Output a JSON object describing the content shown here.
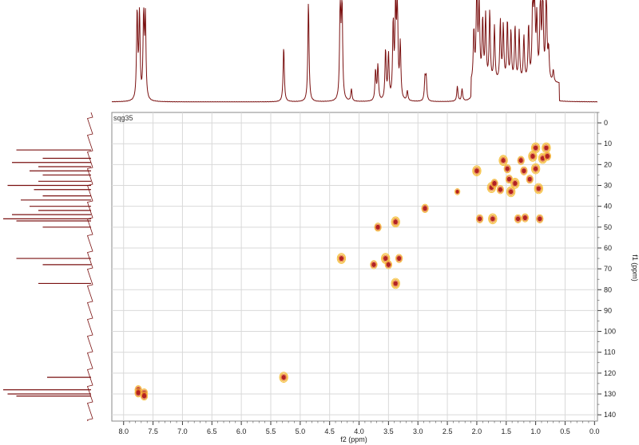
{
  "chart_data": {
    "type": "heatmap",
    "experiment": "HSQC (2D NMR contour plot)",
    "sample_label": "sqg35",
    "xlabel": "f2 (ppm)",
    "ylabel": "f1 (ppm)",
    "x_reversed": true,
    "y_reversed": true,
    "xlim": [
      8.2,
      -0.05
    ],
    "ylim": [
      -5,
      143
    ],
    "x_ticks": [
      "8.0",
      "7.5",
      "7.0",
      "6.5",
      "6.0",
      "5.5",
      "5.0",
      "4.5",
      "4.0",
      "3.5",
      "3.0",
      "2.5",
      "2.0",
      "1.5",
      "1.0",
      "0.5",
      "0.0"
    ],
    "y_ticks": [
      "0",
      "10",
      "20",
      "30",
      "40",
      "50",
      "60",
      "70",
      "80",
      "90",
      "100",
      "110",
      "120",
      "130",
      "140"
    ],
    "grid": true,
    "colors": {
      "contour_dark": "#b22222",
      "contour_mid": "#e8782a",
      "contour_light": "#f5c040",
      "projection": "#7a1010",
      "grid": "#d9d9d9"
    },
    "cross_peaks": [
      {
        "f2": 7.75,
        "f1": 128.0,
        "i": 0.8
      },
      {
        "f2": 7.75,
        "f1": 129.5,
        "i": 0.8
      },
      {
        "f2": 7.65,
        "f1": 129.5,
        "i": 0.8
      },
      {
        "f2": 7.65,
        "f1": 131.0,
        "i": 0.8
      },
      {
        "f2": 5.28,
        "f1": 122.0,
        "i": 0.9
      },
      {
        "f2": 4.3,
        "f1": 65.0,
        "i": 1.0
      },
      {
        "f2": 3.68,
        "f1": 50.0,
        "i": 0.8
      },
      {
        "f2": 3.55,
        "f1": 65.0,
        "i": 0.9
      },
      {
        "f2": 3.5,
        "f1": 68.0,
        "i": 0.8
      },
      {
        "f2": 3.38,
        "f1": 47.5,
        "i": 0.9
      },
      {
        "f2": 3.32,
        "f1": 65.0,
        "i": 0.8
      },
      {
        "f2": 3.38,
        "f1": 77.0,
        "i": 1.0
      },
      {
        "f2": 3.75,
        "f1": 68.0,
        "i": 0.7
      },
      {
        "f2": 2.88,
        "f1": 41.0,
        "i": 0.8
      },
      {
        "f2": 2.33,
        "f1": 33.0,
        "i": 0.6
      },
      {
        "f2": 2.0,
        "f1": 23.0,
        "i": 0.9
      },
      {
        "f2": 1.95,
        "f1": 46.0,
        "i": 0.8
      },
      {
        "f2": 1.75,
        "f1": 31.0,
        "i": 0.9
      },
      {
        "f2": 1.7,
        "f1": 29.0,
        "i": 0.8
      },
      {
        "f2": 1.73,
        "f1": 46.0,
        "i": 0.9
      },
      {
        "f2": 1.6,
        "f1": 32.0,
        "i": 0.8
      },
      {
        "f2": 1.55,
        "f1": 18.0,
        "i": 0.9
      },
      {
        "f2": 1.48,
        "f1": 22.0,
        "i": 0.8
      },
      {
        "f2": 1.45,
        "f1": 27.0,
        "i": 0.8
      },
      {
        "f2": 1.42,
        "f1": 33.0,
        "i": 0.9
      },
      {
        "f2": 1.35,
        "f1": 29.0,
        "i": 0.9
      },
      {
        "f2": 1.3,
        "f1": 46.0,
        "i": 0.8
      },
      {
        "f2": 1.25,
        "f1": 18.0,
        "i": 0.8
      },
      {
        "f2": 1.2,
        "f1": 23.0,
        "i": 0.8
      },
      {
        "f2": 1.18,
        "f1": 45.5,
        "i": 0.8
      },
      {
        "f2": 1.1,
        "f1": 27.0,
        "i": 0.8
      },
      {
        "f2": 1.05,
        "f1": 16.0,
        "i": 0.9
      },
      {
        "f2": 1.0,
        "f1": 12.0,
        "i": 1.0
      },
      {
        "f2": 1.0,
        "f1": 22.0,
        "i": 0.9
      },
      {
        "f2": 0.95,
        "f1": 31.5,
        "i": 1.0
      },
      {
        "f2": 0.93,
        "f1": 46.0,
        "i": 0.8
      },
      {
        "f2": 0.88,
        "f1": 17.0,
        "i": 0.9
      },
      {
        "f2": 0.82,
        "f1": 12.0,
        "i": 1.0
      },
      {
        "f2": 0.8,
        "f1": 16.0,
        "i": 0.8
      }
    ],
    "f2_projection_peaks": [
      {
        "ppm": 7.77,
        "h": 0.88
      },
      {
        "ppm": 7.73,
        "h": 0.85
      },
      {
        "ppm": 7.66,
        "h": 0.82
      },
      {
        "ppm": 7.63,
        "h": 0.8
      },
      {
        "ppm": 5.28,
        "h": 0.55
      },
      {
        "ppm": 4.86,
        "h": 1.0
      },
      {
        "ppm": 4.32,
        "h": 1.0
      },
      {
        "ppm": 4.29,
        "h": 1.0
      },
      {
        "ppm": 4.13,
        "h": 0.12
      },
      {
        "ppm": 3.72,
        "h": 0.3
      },
      {
        "ppm": 3.68,
        "h": 0.35
      },
      {
        "ppm": 3.55,
        "h": 0.5
      },
      {
        "ppm": 3.5,
        "h": 0.45
      },
      {
        "ppm": 3.42,
        "h": 0.75
      },
      {
        "ppm": 3.38,
        "h": 0.88
      },
      {
        "ppm": 3.35,
        "h": 1.0
      },
      {
        "ppm": 3.3,
        "h": 0.55
      },
      {
        "ppm": 3.18,
        "h": 0.1
      },
      {
        "ppm": 2.88,
        "h": 0.22
      },
      {
        "ppm": 2.86,
        "h": 0.22
      },
      {
        "ppm": 2.33,
        "h": 0.15
      },
      {
        "ppm": 2.25,
        "h": 0.12
      },
      {
        "ppm": 2.05,
        "h": 0.5
      },
      {
        "ppm": 2.0,
        "h": 1.0
      },
      {
        "ppm": 1.96,
        "h": 0.8
      },
      {
        "ppm": 1.9,
        "h": 0.6
      },
      {
        "ppm": 1.85,
        "h": 0.65
      },
      {
        "ppm": 1.78,
        "h": 0.7
      },
      {
        "ppm": 1.7,
        "h": 0.55
      },
      {
        "ppm": 1.6,
        "h": 0.6
      },
      {
        "ppm": 1.55,
        "h": 0.55
      },
      {
        "ppm": 1.48,
        "h": 0.6
      },
      {
        "ppm": 1.42,
        "h": 0.5
      },
      {
        "ppm": 1.35,
        "h": 0.55
      },
      {
        "ppm": 1.28,
        "h": 0.5
      },
      {
        "ppm": 1.2,
        "h": 0.45
      },
      {
        "ppm": 1.12,
        "h": 0.55
      },
      {
        "ppm": 1.05,
        "h": 0.8
      },
      {
        "ppm": 1.02,
        "h": 1.0
      },
      {
        "ppm": 0.98,
        "h": 0.6
      },
      {
        "ppm": 0.92,
        "h": 0.85
      },
      {
        "ppm": 0.88,
        "h": 0.95
      },
      {
        "ppm": 0.82,
        "h": 1.0
      },
      {
        "ppm": 0.78,
        "h": 0.3
      },
      {
        "ppm": 0.7,
        "h": 0.12
      }
    ],
    "f1_projection_peaks": [
      {
        "ppm": 13,
        "h": 0.85
      },
      {
        "ppm": 17,
        "h": 0.55
      },
      {
        "ppm": 19,
        "h": 0.9
      },
      {
        "ppm": 21,
        "h": 0.6
      },
      {
        "ppm": 23,
        "h": 0.7
      },
      {
        "ppm": 25,
        "h": 0.55
      },
      {
        "ppm": 28,
        "h": 0.6
      },
      {
        "ppm": 30,
        "h": 0.95
      },
      {
        "ppm": 32,
        "h": 0.65
      },
      {
        "ppm": 35,
        "h": 0.55
      },
      {
        "ppm": 37,
        "h": 0.8
      },
      {
        "ppm": 40,
        "h": 0.7
      },
      {
        "ppm": 42,
        "h": 0.6
      },
      {
        "ppm": 44,
        "h": 0.9
      },
      {
        "ppm": 46,
        "h": 1.0
      },
      {
        "ppm": 47,
        "h": 0.85
      },
      {
        "ppm": 50,
        "h": 0.55
      },
      {
        "ppm": 65,
        "h": 0.85
      },
      {
        "ppm": 68,
        "h": 0.55
      },
      {
        "ppm": 77,
        "h": 0.6
      },
      {
        "ppm": 122,
        "h": 0.5
      },
      {
        "ppm": 128,
        "h": 1.0
      },
      {
        "ppm": 130,
        "h": 0.95
      },
      {
        "ppm": 131,
        "h": 0.85
      }
    ]
  }
}
